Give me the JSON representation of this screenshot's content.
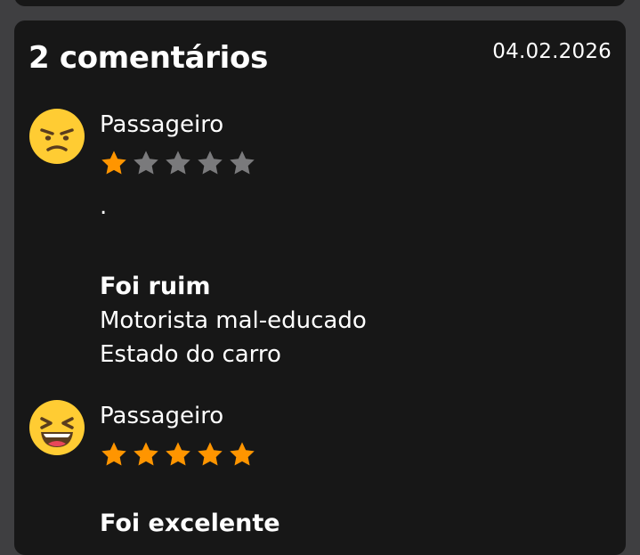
{
  "header": {
    "count_label": "2 comentários",
    "date": "04.02.2026"
  },
  "colors": {
    "background": "#3f3f41",
    "card": "#171717",
    "star_filled": "#ff9500",
    "star_empty": "#7a7a7c",
    "emoji_face": "#ffcc33"
  },
  "comments": [
    {
      "avatar_icon": "angry-face-emoji-icon",
      "author": "Passageiro",
      "rating": 1,
      "max_rating": 5,
      "text": ".",
      "verdict": "Foi ruim",
      "reasons": [
        "Motorista mal-educado",
        "Estado do carro"
      ]
    },
    {
      "avatar_icon": "laughing-face-emoji-icon",
      "author": "Passageiro",
      "rating": 5,
      "max_rating": 5,
      "verdict": "Foi excelente"
    }
  ]
}
